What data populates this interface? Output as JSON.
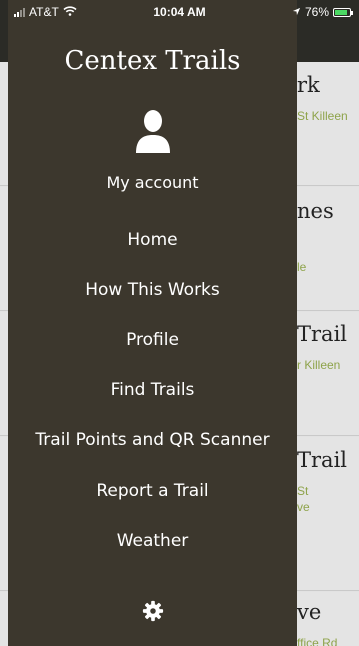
{
  "status_bar": {
    "carrier": "AT&T",
    "time": "10:04 AM",
    "battery": "76%",
    "battery_level": 0.76
  },
  "drawer": {
    "title": "Centex Trails",
    "account_label": "My account",
    "menu": [
      "Home",
      "How This Works",
      "Profile",
      "Find Trails",
      "Trail Points and QR Scanner",
      "Report a Trail",
      "Weather"
    ],
    "icons": {
      "avatar": "user-icon",
      "settings": "gear-icon"
    }
  },
  "background_list": {
    "cards": [
      {
        "title": "rk",
        "subtitle": "St Killeen"
      },
      {
        "title": "nes",
        "subtitle": "le"
      },
      {
        "title": "Trail",
        "subtitle": "r Killeen"
      },
      {
        "title": "Trail",
        "subtitle_lines": [
          "St",
          "ve"
        ]
      },
      {
        "title": "ve",
        "subtitle": "ffice Rd"
      }
    ]
  },
  "colors": {
    "drawer_bg": "#3c372d",
    "topbar_bg": "#2b2b26",
    "accent_green": "#8ea34a",
    "battery_green": "#4cd964"
  }
}
